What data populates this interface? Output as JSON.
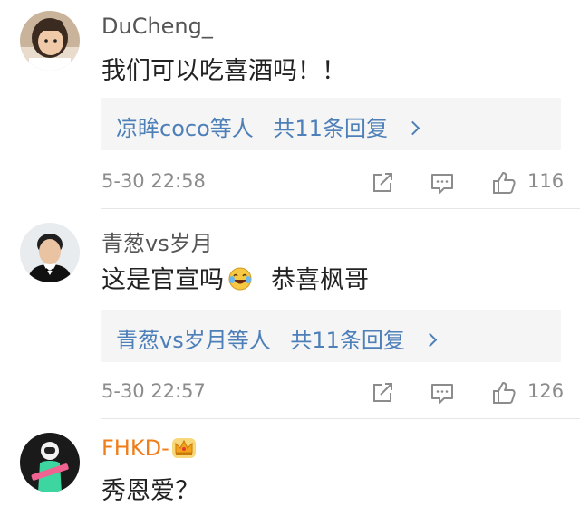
{
  "comments": [
    {
      "username": "DuCheng_",
      "text": "我们可以吃喜酒吗！！",
      "replies_by": "凉眸coco等人",
      "replies_count": "共11条回复",
      "time": "5-30 22:58",
      "likes": "116",
      "avatar_icon": "child-photo-avatar"
    },
    {
      "username": "青葱vs岁月",
      "text_before": "这是官宣吗",
      "text_after": "恭喜枫哥",
      "emoji_icon": "laughing-tears-emoji",
      "replies_by": "青葱vs岁月等人",
      "replies_count": "共11条回复",
      "time": "5-30 22:57",
      "likes": "126",
      "avatar_icon": "man-in-tuxedo-avatar"
    },
    {
      "username": "FHKD-",
      "badge_icon": "crown-badge-icon",
      "text": "秀恩爱？",
      "avatar_icon": "astronaut-avatar",
      "colors": {
        "username": "#ef7d1a"
      }
    }
  ],
  "colors": {
    "link": "#4d7fb8",
    "meta": "#8c8c8c",
    "reply_bg": "#f5f5f5"
  }
}
